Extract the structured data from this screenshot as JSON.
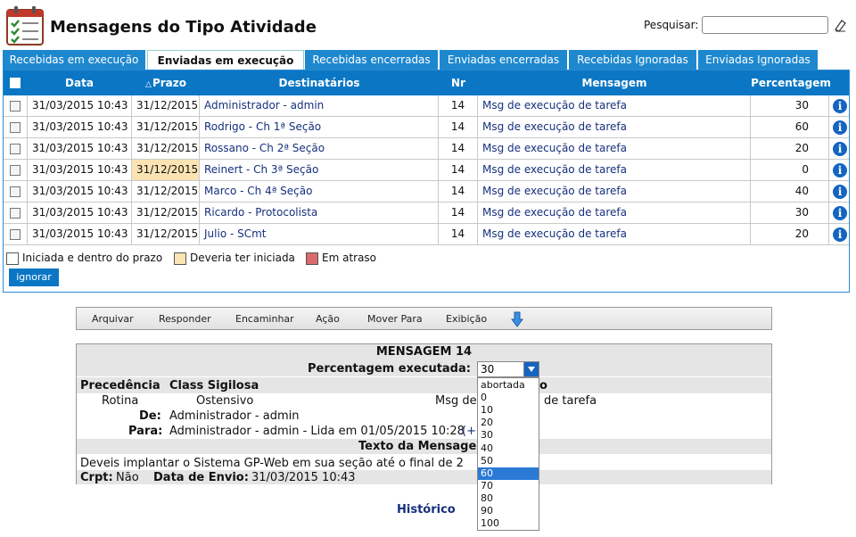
{
  "header": {
    "title": "Mensagens do Tipo Atividade",
    "search_label": "Pesquisar:",
    "search_value": ""
  },
  "tabs": [
    {
      "label": "Recebidas em execução",
      "active": false
    },
    {
      "label": "Enviadas em execução",
      "active": true
    },
    {
      "label": "Recebidas encerradas",
      "active": false
    },
    {
      "label": "Enviadas encerradas",
      "active": false
    },
    {
      "label": "Recebidas Ignoradas",
      "active": false
    },
    {
      "label": "Enviadas Ignoradas",
      "active": false
    }
  ],
  "table": {
    "columns": [
      "Data",
      "Prazo",
      "Destinatários",
      "Nr",
      "Mensagem",
      "Percentagem"
    ],
    "rows": [
      {
        "data": "31/03/2015 10:43",
        "prazo": "31/12/2015",
        "dest": "Administrador - admin",
        "nr": "14",
        "msg": "Msg de execução de tarefa",
        "pct": "30",
        "prazo_status": "normal"
      },
      {
        "data": "31/03/2015 10:43",
        "prazo": "31/12/2015",
        "dest": "Rodrigo - Ch 1ª Seção",
        "nr": "14",
        "msg": "Msg de execução de tarefa",
        "pct": "60",
        "prazo_status": "normal"
      },
      {
        "data": "31/03/2015 10:43",
        "prazo": "31/12/2015",
        "dest": "Rossano - Ch 2ª Seção",
        "nr": "14",
        "msg": "Msg de execução de tarefa",
        "pct": "20",
        "prazo_status": "normal"
      },
      {
        "data": "31/03/2015 10:43",
        "prazo": "31/12/2015",
        "dest": "Reinert - Ch 3ª Seção",
        "nr": "14",
        "msg": "Msg de execução de tarefa",
        "pct": "0",
        "prazo_status": "deveria"
      },
      {
        "data": "31/03/2015 10:43",
        "prazo": "31/12/2015",
        "dest": "Marco - Ch 4ª Seção",
        "nr": "14",
        "msg": "Msg de execução de tarefa",
        "pct": "40",
        "prazo_status": "normal"
      },
      {
        "data": "31/03/2015 10:43",
        "prazo": "31/12/2015",
        "dest": "Ricardo - Protocolista",
        "nr": "14",
        "msg": "Msg de execução de tarefa",
        "pct": "30",
        "prazo_status": "normal"
      },
      {
        "data": "31/03/2015 10:43",
        "prazo": "31/12/2015",
        "dest": "Julio - SCmt",
        "nr": "14",
        "msg": "Msg de execução de tarefa",
        "pct": "20",
        "prazo_status": "normal"
      }
    ]
  },
  "legend": [
    {
      "label": "Iniciada e dentro do prazo",
      "color": "#ffffff"
    },
    {
      "label": "Deveria ter iniciada",
      "color": "#fbe3b3"
    },
    {
      "label": "Em atraso",
      "color": "#d96b6b"
    }
  ],
  "ignore_button": "ignorar",
  "toolbar": [
    "Arquivar",
    "Responder",
    "Encaminhar",
    "Ação",
    "Mover Para",
    "Exibição"
  ],
  "message": {
    "title": "MENSAGEM 14",
    "pct_label": "Percentagem executada:",
    "pct_value": "30",
    "precedencia_label": "Precedência",
    "class_label": "Class Sigilosa",
    "assunto_tail": "o",
    "precedencia": "Rotina",
    "class": "Ostensivo",
    "assunto_a": "Msg de",
    "assunto_b": "de tarefa",
    "de_label": "De:",
    "de": "Administrador - admin",
    "para_label": "Para:",
    "para": "Administrador - admin - Lida em 01/05/2015 10:28",
    "para_more": "(+",
    "texto_label": "Texto da Mensage",
    "texto": "Deveis implantar o Sistema GP-Web em sua seção até o final de 2",
    "crpt_label": "Crpt:",
    "crpt": "Não",
    "envio_label": "Data de Envio:",
    "envio": "31/03/2015 10:43"
  },
  "dropdown_options": [
    "abortada",
    "0",
    "10",
    "20",
    "30",
    "40",
    "50",
    "60",
    "70",
    "80",
    "90",
    "100"
  ],
  "dropdown_selected": "60",
  "historico": "Histórico"
}
